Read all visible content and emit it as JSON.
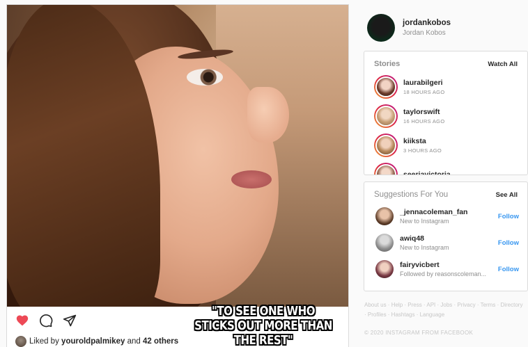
{
  "post": {
    "meme_text": "\"TO SEE ONE WHO STICKS OUT MORE THAN THE REST\"",
    "liked_prefix": "Liked by",
    "liked_user": "youroldpalmikey",
    "liked_and": "and",
    "liked_others": "42 others"
  },
  "profile": {
    "username": "jordankobos",
    "full_name": "Jordan Kobos"
  },
  "stories": {
    "title": "Stories",
    "watch_all": "Watch All",
    "items": [
      {
        "name": "laurabilgeri",
        "time": "18 HOURS AGO"
      },
      {
        "name": "taylorswift",
        "time": "16 HOURS AGO"
      },
      {
        "name": "kiiksta",
        "time": "3 HOURS AGO"
      },
      {
        "name": "seeriavictoria",
        "time": ""
      }
    ]
  },
  "suggestions": {
    "title": "Suggestions For You",
    "see_all": "See All",
    "follow_label": "Follow",
    "items": [
      {
        "name": "_jennacoleman_fan",
        "sub": "New to Instagram"
      },
      {
        "name": "awiq48",
        "sub": "New to Instagram"
      },
      {
        "name": "fairyvicbert",
        "sub": "Followed by reasonscoleman..."
      }
    ]
  },
  "footer": {
    "links": "About us · Help · Press · API · Jobs · Privacy · Terms · Directory · Profiles · Hashtags · Language",
    "copyright": "© 2020 INSTAGRAM FROM FACEBOOK"
  },
  "colors": {
    "like": "#ed4956",
    "follow": "#3897f0",
    "muted": "#8e8e8e"
  }
}
